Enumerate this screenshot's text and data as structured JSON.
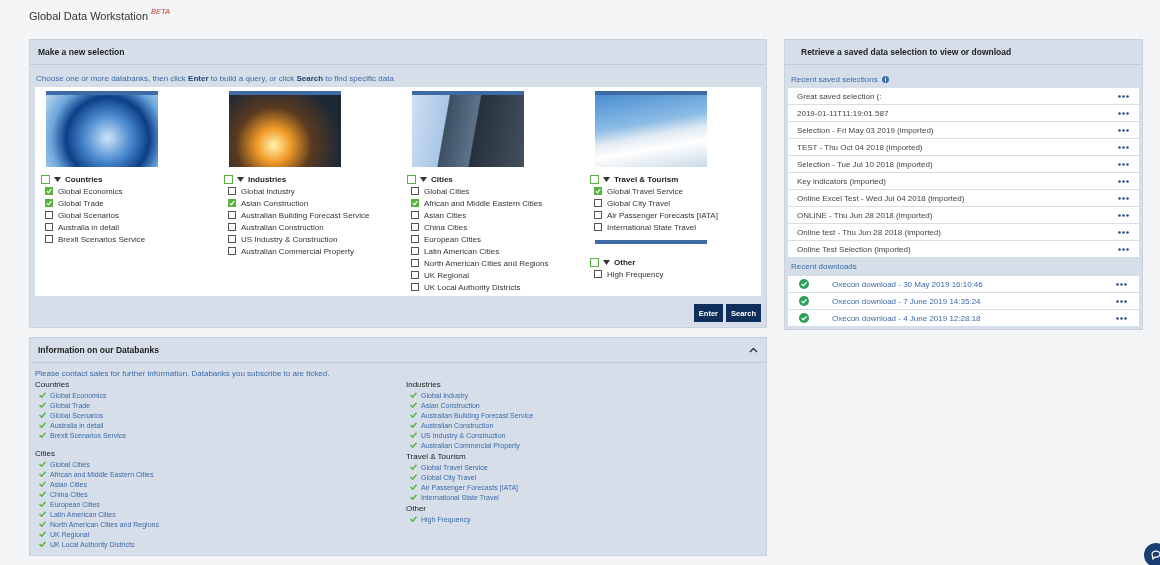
{
  "app": {
    "title": "Global Data Workstation",
    "badge": "BETA"
  },
  "selection": {
    "title": "Make a new selection",
    "hint": "Choose one or more databanks, then click **Enter** to build a query, or click **Search** to find specific data",
    "columns": [
      {
        "kind": "globe",
        "groups": [
          {
            "name": "Countries",
            "checked": false,
            "items": [
              {
                "label": "Global Economics",
                "checked": true
              },
              {
                "label": "Global Trade",
                "checked": true
              },
              {
                "label": "Global Scenarios",
                "checked": false
              },
              {
                "label": "Australia in detail",
                "checked": false
              },
              {
                "label": "Brexit Scenarios Service",
                "checked": false
              }
            ]
          }
        ]
      },
      {
        "kind": "sparks",
        "groups": [
          {
            "name": "Industries",
            "checked": false,
            "items": [
              {
                "label": "Global Industry",
                "checked": false
              },
              {
                "label": "Asian Construction",
                "checked": true
              },
              {
                "label": "Australian Building Forecast Service",
                "checked": false
              },
              {
                "label": "Australian Construction",
                "checked": false
              },
              {
                "label": "US Industry & Construction",
                "checked": false
              },
              {
                "label": "Australian Commercial Property",
                "checked": false
              }
            ]
          }
        ]
      },
      {
        "kind": "building",
        "groups": [
          {
            "name": "Cities",
            "checked": false,
            "items": [
              {
                "label": "Global Cities",
                "checked": false
              },
              {
                "label": "African and Middle Eastern Cities",
                "checked": true
              },
              {
                "label": "Asian Cities",
                "checked": false
              },
              {
                "label": "China Cities",
                "checked": false
              },
              {
                "label": "European Cities",
                "checked": false
              },
              {
                "label": "Latin American Cities",
                "checked": false
              },
              {
                "label": "North American Cities and Regions",
                "checked": false
              },
              {
                "label": "UK Regional",
                "checked": false
              },
              {
                "label": "UK Local Authority Districts",
                "checked": false
              }
            ]
          }
        ]
      },
      {
        "kind": "wing",
        "groups": [
          {
            "name": "Travel & Tourism",
            "checked": false,
            "items": [
              {
                "label": "Global Travel Service",
                "checked": true
              },
              {
                "label": "Global City Travel",
                "checked": false
              },
              {
                "label": "Air Passenger Forecasts [IATA]",
                "checked": false
              },
              {
                "label": "International State Travel",
                "checked": false
              }
            ]
          },
          {
            "name": "Other",
            "checked": false,
            "items": [
              {
                "label": "High Frequency",
                "checked": false
              }
            ]
          }
        ]
      }
    ],
    "buttons": [
      "Enter",
      "Search"
    ]
  },
  "info": {
    "title": "Information on our Databanks",
    "expanded": true,
    "note": "Please contact sales for further information. Databanks you subscribe to are ticked.",
    "columns": [
      [
        {
          "name": "Countries",
          "items": [
            {
              "label": "Global Economics",
              "ticked": true
            },
            {
              "label": "Global Trade",
              "ticked": true
            },
            {
              "label": "Global Scenarios",
              "ticked": true
            },
            {
              "label": "Australia in detail",
              "ticked": true
            },
            {
              "label": "Brexit Scenarios Service",
              "ticked": true
            }
          ]
        },
        {
          "name": "Cities",
          "items": [
            {
              "label": "Global Cities",
              "ticked": true
            },
            {
              "label": "African and Middle Eastern Cities",
              "ticked": true
            },
            {
              "label": "Asian Cities",
              "ticked": true
            },
            {
              "label": "China Cities",
              "ticked": true
            },
            {
              "label": "European Cities",
              "ticked": true
            },
            {
              "label": "Latin American Cities",
              "ticked": true
            },
            {
              "label": "North American Cities and Regions",
              "ticked": true
            },
            {
              "label": "UK Regional",
              "ticked": true
            },
            {
              "label": "UK Local Authority Districts",
              "ticked": true
            }
          ]
        }
      ],
      [
        {
          "name": "Industries",
          "items": [
            {
              "label": "Global Industry",
              "ticked": true
            },
            {
              "label": "Asian Construction",
              "ticked": true
            },
            {
              "label": "Australian Building Forecast Service",
              "ticked": true
            },
            {
              "label": "Australian Construction",
              "ticked": true
            },
            {
              "label": "US Industry & Construction",
              "ticked": true
            },
            {
              "label": "Australian Commercial Property",
              "ticked": true
            }
          ]
        },
        {
          "name": "Travel & Tourism",
          "items": [
            {
              "label": "Global Travel Service",
              "ticked": true
            },
            {
              "label": "Global City Travel",
              "ticked": true
            },
            {
              "label": "Air Passenger Forecasts [IATA]",
              "ticked": true
            },
            {
              "label": "International State Travel",
              "ticked": true
            }
          ]
        },
        {
          "name": "Other",
          "items": [
            {
              "label": "High Frequency",
              "ticked": true
            }
          ]
        }
      ]
    ]
  },
  "saved": {
    "title": "Retrieve a saved data selection to view or download",
    "recent_label": "Recent saved selections",
    "selections": [
      {
        "label": "Great saved selection (:"
      },
      {
        "label": "2019-01-11T11:19:01.587"
      },
      {
        "label": "Selection - Fri May 03 2019 (imported)"
      },
      {
        "label": "TEST - Thu Oct 04 2018 (imported)"
      },
      {
        "label": "Selection - Tue Jul 10 2018 (imported)"
      },
      {
        "label": "Key indicators (imported)"
      },
      {
        "label": "Online Excel Test - Wed Jul 04 2018 (imported)"
      },
      {
        "label": "ONLINE - Thu Jun 28 2018 (imported)"
      },
      {
        "label": "Online test - Thu Jun 28 2018 (imported)"
      },
      {
        "label": "Online Test Selection (imported)"
      }
    ],
    "downloads_label": "Recent downloads",
    "downloads": [
      {
        "label": "Oxecon download - 30 May 2019 16:10:46",
        "kind": "complete"
      },
      {
        "label": "Oxecon download - 7 June 2019 14:35:24",
        "kind": "complete"
      },
      {
        "label": "Oxecon download - 4 June 2019 12:28:18",
        "kind": "complete"
      }
    ]
  }
}
